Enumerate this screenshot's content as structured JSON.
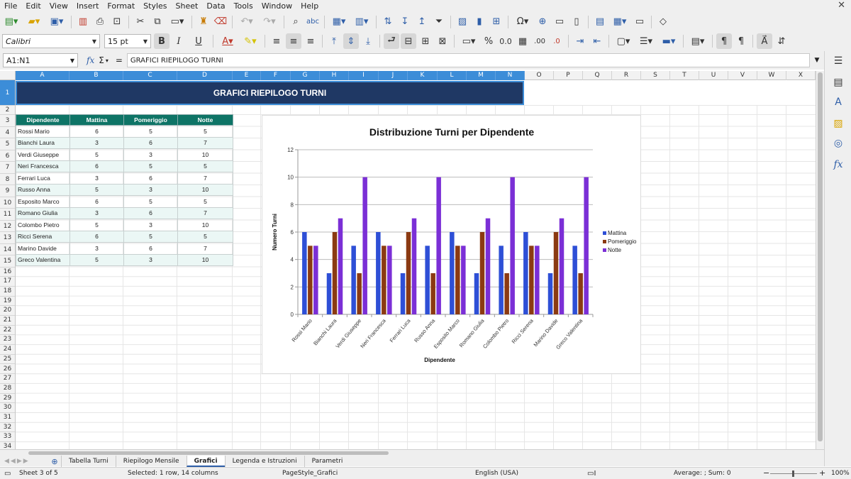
{
  "menu": [
    "File",
    "Edit",
    "View",
    "Insert",
    "Format",
    "Styles",
    "Sheet",
    "Data",
    "Tools",
    "Window",
    "Help"
  ],
  "toolbar": {
    "font_name": "Calibri",
    "font_size": "15 pt",
    "bold_label": "B",
    "italic_label": "I",
    "underline_label": "U"
  },
  "formula_bar": {
    "name_box": "A1:N1",
    "formula": "GRAFICI RIEPILOGO TURNI",
    "fx": "fx",
    "sigma": "Σ",
    "equals": "="
  },
  "columns": [
    "A",
    "B",
    "C",
    "D",
    "E",
    "F",
    "G",
    "H",
    "I",
    "J",
    "K",
    "L",
    "M",
    "N",
    "O",
    "P",
    "Q",
    "R",
    "S",
    "T",
    "U",
    "V",
    "W",
    "X"
  ],
  "rows": [
    "1",
    "2",
    "3",
    "4",
    "5",
    "6",
    "7",
    "8",
    "9",
    "10",
    "11",
    "12",
    "13",
    "14",
    "15",
    "16",
    "17",
    "18",
    "19",
    "20",
    "21",
    "22",
    "23",
    "24",
    "25",
    "26",
    "27",
    "28",
    "29",
    "30",
    "31",
    "32",
    "33",
    "34"
  ],
  "banner_title": "GRAFICI RIEPILOGO TURNI",
  "table": {
    "headers": [
      "Dipendente",
      "Mattina",
      "Pomeriggio",
      "Notte"
    ],
    "rows": [
      [
        "Rossi Mario",
        "6",
        "5",
        "5"
      ],
      [
        "Bianchi Laura",
        "3",
        "6",
        "7"
      ],
      [
        "Verdi Giuseppe",
        "5",
        "3",
        "10"
      ],
      [
        "Neri Francesca",
        "6",
        "5",
        "5"
      ],
      [
        "Ferrari Luca",
        "3",
        "6",
        "7"
      ],
      [
        "Russo Anna",
        "5",
        "3",
        "10"
      ],
      [
        "Esposito Marco",
        "6",
        "5",
        "5"
      ],
      [
        "Romano Giulia",
        "3",
        "6",
        "7"
      ],
      [
        "Colombo Pietro",
        "5",
        "3",
        "10"
      ],
      [
        "Ricci Serena",
        "6",
        "5",
        "5"
      ],
      [
        "Marino Davide",
        "3",
        "6",
        "7"
      ],
      [
        "Greco Valentina",
        "5",
        "3",
        "10"
      ]
    ]
  },
  "chart_data": {
    "type": "bar",
    "title": "Distribuzione Turni per Dipendente",
    "xlabel": "Dipendente",
    "ylabel": "Numero Turni",
    "ylim": [
      0,
      12
    ],
    "yticks": [
      0,
      2,
      4,
      6,
      8,
      10,
      12
    ],
    "grid": true,
    "legend": "right",
    "categories": [
      "Rossi Mario",
      "Bianchi Laura",
      "Verdi Giuseppe",
      "Neri Francesca",
      "Ferrari Luca",
      "Russo Anna",
      "Esposito Marco",
      "Romano Giulia",
      "Colombo Pietro",
      "Ricci Serena",
      "Marino Davide",
      "Greco Valentina"
    ],
    "series": [
      {
        "name": "Mattina",
        "color": "#2e4fd6",
        "values": [
          6,
          3,
          5,
          6,
          3,
          5,
          6,
          3,
          5,
          6,
          3,
          5
        ]
      },
      {
        "name": "Pomeriggio",
        "color": "#8b3a12",
        "values": [
          5,
          6,
          3,
          5,
          6,
          3,
          5,
          6,
          3,
          5,
          6,
          3
        ]
      },
      {
        "name": "Notte",
        "color": "#7b2fd6",
        "values": [
          5,
          7,
          10,
          5,
          7,
          10,
          5,
          7,
          10,
          5,
          7,
          10
        ]
      }
    ]
  },
  "sheet_tabs": [
    "Tabella Turni",
    "Riepilogo Mensile",
    "Grafici",
    "Legenda e Istruzioni",
    "Parametri"
  ],
  "active_tab": "Grafici",
  "status": {
    "sheet": "Sheet 3 of 5",
    "selection": "Selected: 1 row, 14 columns",
    "page_style": "PageStyle_Grafici",
    "language": "English (USA)",
    "summary": "Average: ; Sum: 0",
    "zoom": "100%"
  },
  "colors": {
    "banner": "#1f3864",
    "table_header": "#0e7466",
    "selection": "#3c8dd8"
  }
}
